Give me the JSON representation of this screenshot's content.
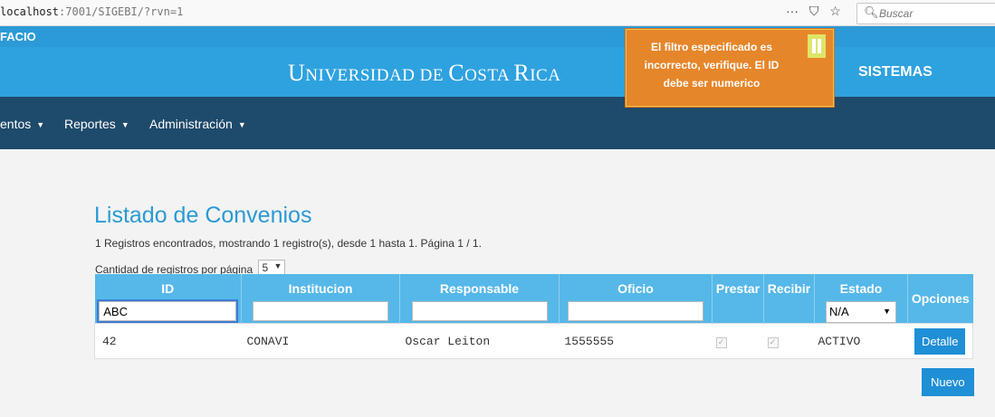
{
  "browser": {
    "url_host": "localhost",
    "url_rest": ":7001/SIGEBI/?rvn=1",
    "menu_glyph": "···",
    "pocket_glyph": "⛉",
    "star_glyph": "☆",
    "search_placeholder": "Buscar"
  },
  "header": {
    "strip_label": "FACIO",
    "university_u": "U",
    "university_rest1": "NIVERSIDAD DE ",
    "university_c": "C",
    "university_rest2": "OSTA ",
    "university_r": "R",
    "university_rest3": "ICA",
    "section": "SISTEMAS"
  },
  "toast": {
    "message": "El filtro especificado es incorrecto, verifique. El ID debe ser numerico"
  },
  "nav": {
    "items": [
      {
        "label": "entos"
      },
      {
        "label": "Reportes"
      },
      {
        "label": "Administración"
      }
    ]
  },
  "page": {
    "title": "Listado de Convenios",
    "summary": "1 Registros encontrados, mostrando 1 registro(s), desde 1 hasta 1. Página 1 / 1.",
    "per_page_label": "Cantidad de registros por página",
    "per_page_value": "5"
  },
  "table": {
    "headers": {
      "id": "ID",
      "institucion": "Institucion",
      "responsable": "Responsable",
      "oficio": "Oficio",
      "prestar": "Prestar",
      "recibir": "Recibir",
      "estado": "Estado",
      "opciones": "Opciones"
    },
    "filters": {
      "id": "ABC",
      "institucion": "",
      "responsable": "",
      "oficio": "",
      "estado": "N/A"
    },
    "rows": [
      {
        "id": "42",
        "institucion": "CONAVI",
        "responsable": "Oscar Leiton",
        "oficio": "1555555",
        "prestar": true,
        "recibir": true,
        "estado": "ACTIVO",
        "action": "Detalle"
      }
    ]
  },
  "buttons": {
    "nuevo": "Nuevo"
  }
}
